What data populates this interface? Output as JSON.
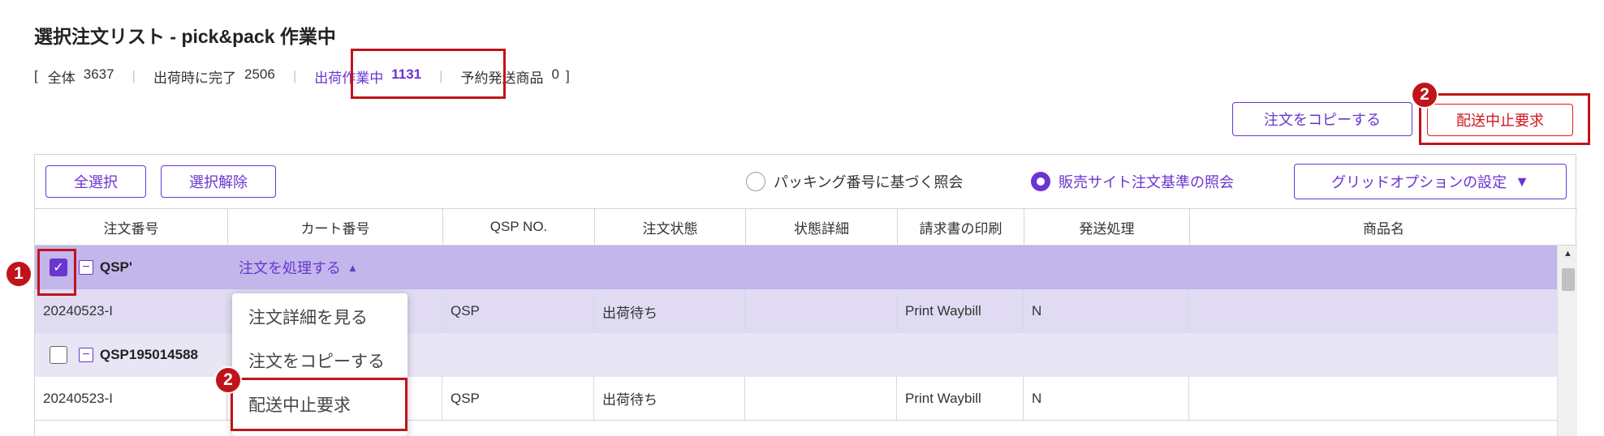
{
  "page": {
    "title": "選択注文リスト - pick&pack 作業中"
  },
  "summary": {
    "open_bracket": "[",
    "close_bracket": "]",
    "separator": "|",
    "total_label": "全体",
    "total_value": "3637",
    "completed_label": "出荷時に完了",
    "completed_value": "2506",
    "working_label": "出荷作業中",
    "working_value": "1131",
    "reserved_label": "予約発送商品",
    "reserved_value": "0"
  },
  "actions": {
    "copy_order": "注文をコピーする",
    "cancel_shipping": "配送中止要求"
  },
  "toolbar": {
    "select_all": "全選択",
    "deselect": "選択解除",
    "radio_packing": "パッキング番号に基づく照会",
    "radio_site": "販売サイト注文基準の照会",
    "radio_selected": "site",
    "grid_options": "グリッドオプションの設定",
    "grid_options_arrow": "▼"
  },
  "table": {
    "columns": [
      "注文番号",
      "カート番号",
      "QSP NO.",
      "注文状態",
      "状態詳細",
      "請求書の印刷",
      "発送処理",
      "商品名"
    ],
    "group1": {
      "checked": true,
      "id": "QSP'",
      "action": "注文を処理する",
      "action_arrow": "▲"
    },
    "row1": {
      "order_no": "20240523-I",
      "qsp_no": "QSP",
      "status": "出荷待ち",
      "detail": "",
      "print": "Print Waybill",
      "ship": "N",
      "product": ""
    },
    "group2": {
      "checked": false,
      "id": "QSP195014588"
    },
    "row2": {
      "order_no": "20240523-I",
      "qsp_no": "QSP",
      "status": "出荷待ち",
      "detail": "",
      "print": "Print Waybill",
      "ship": "N",
      "product": ""
    }
  },
  "dropdown": {
    "items": [
      "注文詳細を見る",
      "注文をコピーする",
      "配送中止要求"
    ]
  },
  "badges": {
    "one": "1",
    "two": "2"
  },
  "colors": {
    "accent": "#6a35d1",
    "highlight": "#c0141a",
    "danger": "#e8151a",
    "group_row": "#c3b6ea"
  },
  "icons": {
    "checkbox": "check-icon",
    "collapse": "minus-square-icon",
    "scroll_up": "triangle-up-icon"
  }
}
